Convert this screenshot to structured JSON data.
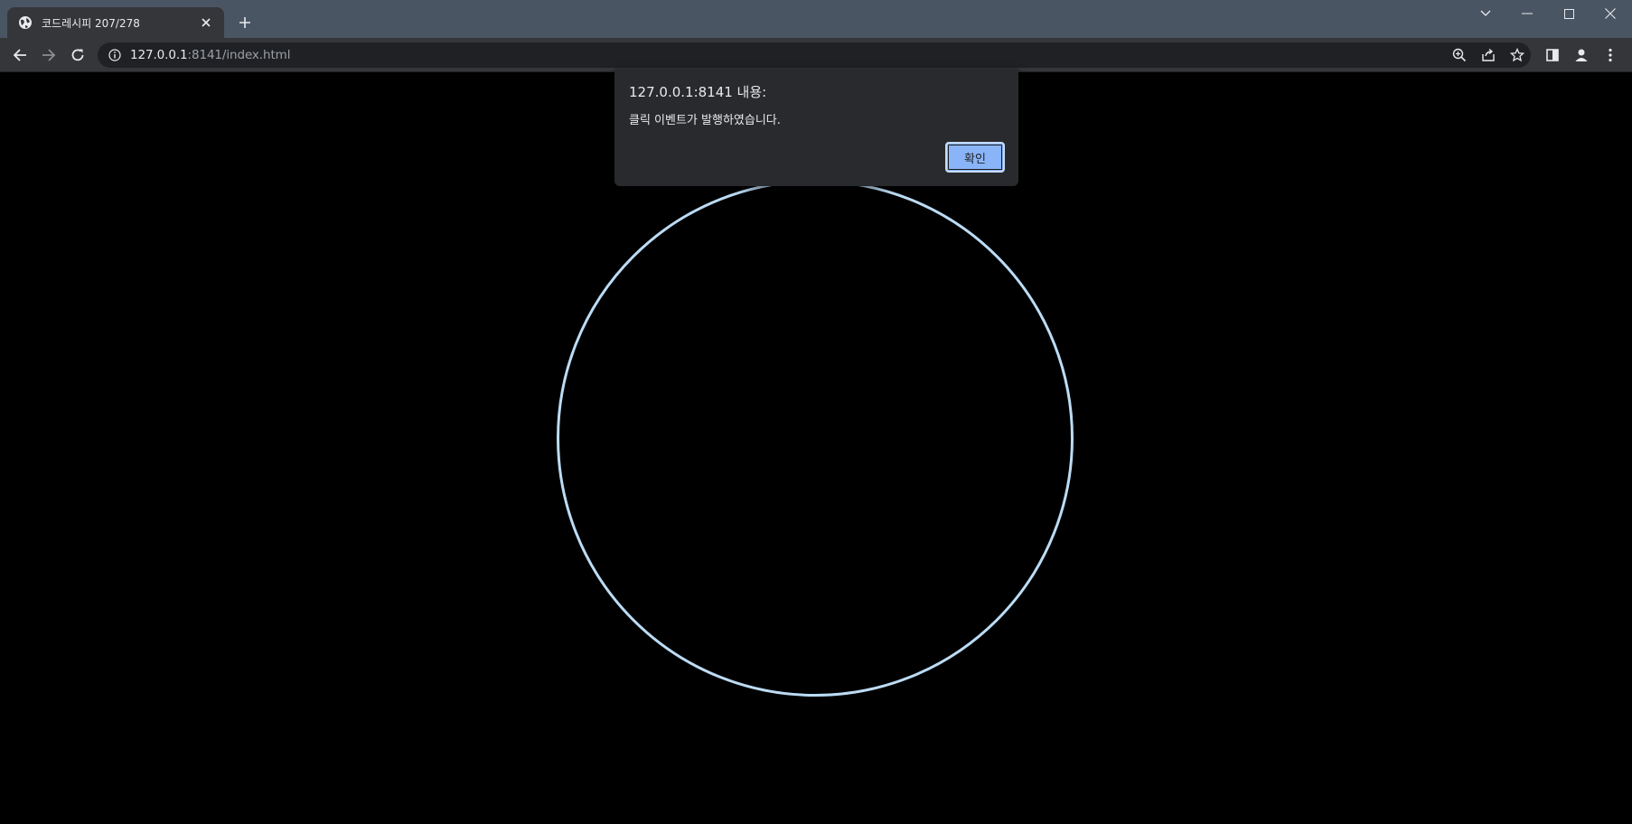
{
  "browser": {
    "tab": {
      "title": "코드레시피 207/278",
      "favicon": "globe-icon"
    },
    "window_controls": [
      "chevron-down-icon",
      "minimize-icon",
      "maximize-icon",
      "close-icon"
    ],
    "toolbar": {
      "back_icon": "arrow-left-icon",
      "forward_icon": "arrow-right-icon",
      "reload_icon": "reload-icon",
      "info_icon": "info-icon",
      "url_host": "127.0.0.1",
      "url_rest": ":8141/index.html",
      "right_icons": [
        "zoom-icon",
        "share-icon",
        "star-icon",
        "side-panel-icon",
        "profile-icon",
        "more-icon"
      ]
    }
  },
  "dialog": {
    "title": "127.0.0.1:8141 내용:",
    "message": "클릭 이벤트가 발행하였습니다.",
    "ok_label": "확인"
  },
  "colors": {
    "tabstrip": "#4a5563",
    "toolbar": "#35363a",
    "page_background": "#000000",
    "circle_stroke": "#bcdcf5",
    "dialog_background": "#292a2d",
    "ok_button": "#8ab4f8"
  }
}
